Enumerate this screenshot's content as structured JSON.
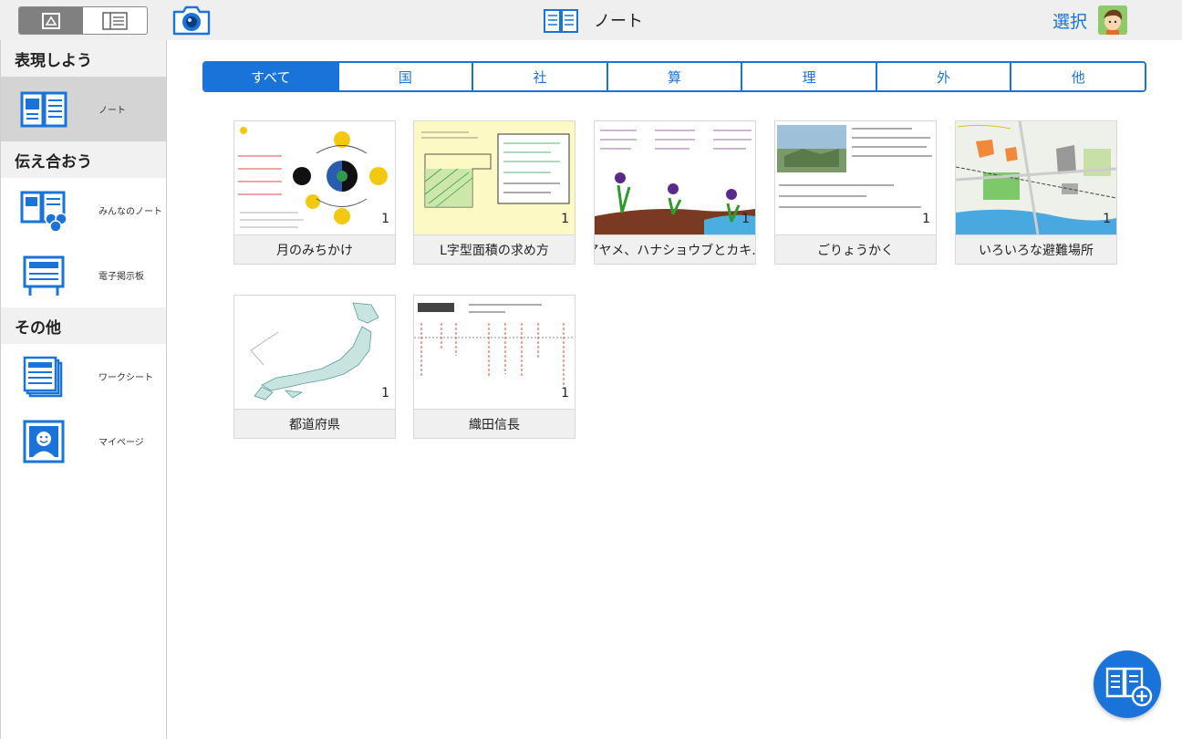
{
  "header": {
    "title": "ノート",
    "select_label": "選択",
    "view_toggle": [
      "grid-view",
      "list-view"
    ]
  },
  "sidebar": {
    "sections": [
      {
        "title": "表現しよう",
        "items": [
          {
            "label": "ノート",
            "icon": "notebook-icon",
            "active": true
          }
        ]
      },
      {
        "title": "伝え合おう",
        "items": [
          {
            "label": "みんなのノート",
            "icon": "shared-notebook-icon"
          },
          {
            "label": "電子掲示板",
            "icon": "bulletin-board-icon"
          }
        ]
      },
      {
        "title": "その他",
        "items": [
          {
            "label": "ワークシート",
            "icon": "worksheet-icon"
          },
          {
            "label": "マイページ",
            "icon": "mypage-icon"
          }
        ]
      }
    ]
  },
  "tabs": [
    "すべて",
    "国",
    "社",
    "算",
    "理",
    "外",
    "他"
  ],
  "active_tab": "すべて",
  "notes": [
    {
      "title": "月のみちかけ",
      "count": "1"
    },
    {
      "title": "L字型面積の求め方",
      "count": "1"
    },
    {
      "title": "アヤメ、ハナショウブとカキ...",
      "count": "1"
    },
    {
      "title": "ごりょうかく",
      "count": "1"
    },
    {
      "title": "いろいろな避難場所",
      "count": "1"
    },
    {
      "title": "都道府県",
      "count": "1"
    },
    {
      "title": "織田信長",
      "count": "1"
    }
  ],
  "colors": {
    "accent": "#1a73d9",
    "active_side": "#d4d4d4"
  }
}
